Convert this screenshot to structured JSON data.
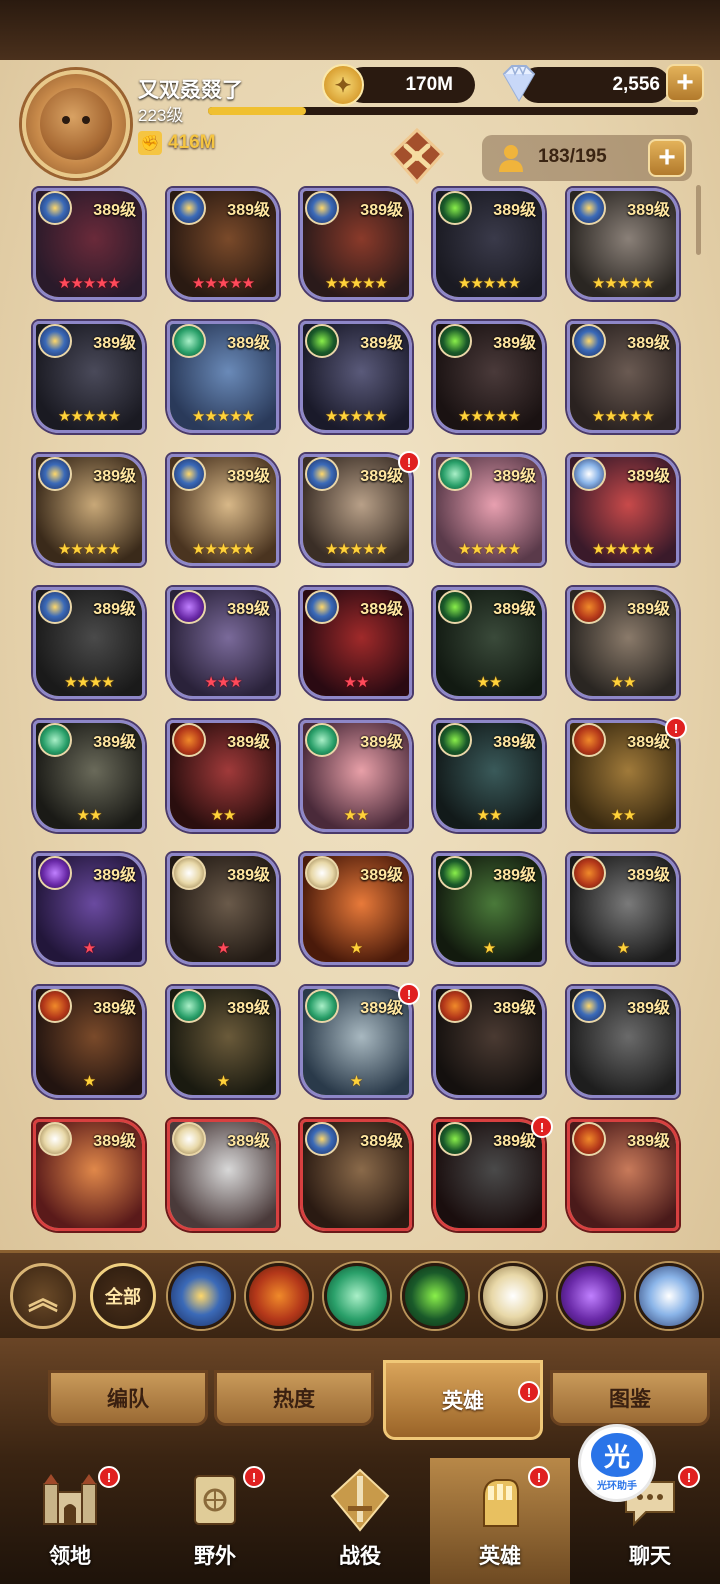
{
  "player": {
    "name": "又双叒叕了",
    "level": "223级",
    "level_progress": 0.2,
    "power": "416M"
  },
  "resources": {
    "gold": "170M",
    "diamonds": "2,556"
  },
  "roster": {
    "count": "183/195"
  },
  "colors": {
    "accent": "#f5c542",
    "alert": "#e02020",
    "card_border": "#8e87c8",
    "card_border_elite": "#d84040"
  },
  "heroes": [
    {
      "level": "389级",
      "stars": 5,
      "star_color": "red",
      "faction": "lightbearer",
      "alert": false,
      "elite": false
    },
    {
      "level": "389级",
      "stars": 5,
      "star_color": "red",
      "faction": "lightbearer",
      "alert": false,
      "elite": false
    },
    {
      "level": "389级",
      "stars": 5,
      "star_color": "gold",
      "faction": "lightbearer",
      "alert": false,
      "elite": false
    },
    {
      "level": "389级",
      "stars": 5,
      "star_color": "gold",
      "faction": "wilder",
      "alert": false,
      "elite": false
    },
    {
      "level": "389级",
      "stars": 5,
      "star_color": "gold",
      "faction": "lightbearer",
      "alert": false,
      "elite": false
    },
    {
      "level": "389级",
      "stars": 5,
      "star_color": "gold",
      "faction": "lightbearer",
      "alert": false,
      "elite": false
    },
    {
      "level": "389级",
      "stars": 5,
      "star_color": "gold",
      "faction": "wilder-green",
      "alert": false,
      "elite": false
    },
    {
      "level": "389级",
      "stars": 5,
      "star_color": "gold",
      "faction": "wilder",
      "alert": false,
      "elite": false
    },
    {
      "level": "389级",
      "stars": 5,
      "star_color": "gold",
      "faction": "wilder",
      "alert": false,
      "elite": false
    },
    {
      "level": "389级",
      "stars": 5,
      "star_color": "gold",
      "faction": "lightbearer",
      "alert": false,
      "elite": false
    },
    {
      "level": "389级",
      "stars": 5,
      "star_color": "gold",
      "faction": "lightbearer",
      "alert": false,
      "elite": false
    },
    {
      "level": "389级",
      "stars": 5,
      "star_color": "gold",
      "faction": "lightbearer",
      "alert": false,
      "elite": false
    },
    {
      "level": "389级",
      "stars": 5,
      "star_color": "gold",
      "faction": "lightbearer",
      "alert": true,
      "elite": false
    },
    {
      "level": "389级",
      "stars": 5,
      "star_color": "gold",
      "faction": "wilder-green",
      "alert": false,
      "elite": false
    },
    {
      "level": "389级",
      "stars": 5,
      "star_color": "gold",
      "faction": "dimensional",
      "alert": false,
      "elite": false
    },
    {
      "level": "389级",
      "stars": 4,
      "star_color": "gold",
      "faction": "lightbearer",
      "alert": false,
      "elite": false
    },
    {
      "level": "389级",
      "stars": 3,
      "star_color": "red",
      "faction": "graveborn",
      "alert": false,
      "elite": false
    },
    {
      "level": "389级",
      "stars": 2,
      "star_color": "red",
      "faction": "lightbearer",
      "alert": false,
      "elite": false
    },
    {
      "level": "389级",
      "stars": 2,
      "star_color": "gold",
      "faction": "wilder",
      "alert": false,
      "elite": false
    },
    {
      "level": "389级",
      "stars": 2,
      "star_color": "gold",
      "faction": "mauler",
      "alert": false,
      "elite": false
    },
    {
      "level": "389级",
      "stars": 2,
      "star_color": "gold",
      "faction": "wilder-green",
      "alert": false,
      "elite": false
    },
    {
      "level": "389级",
      "stars": 2,
      "star_color": "gold",
      "faction": "mauler",
      "alert": false,
      "elite": false
    },
    {
      "level": "389级",
      "stars": 2,
      "star_color": "gold",
      "faction": "wilder-green",
      "alert": false,
      "elite": false
    },
    {
      "level": "389级",
      "stars": 2,
      "star_color": "gold",
      "faction": "wilder",
      "alert": false,
      "elite": false
    },
    {
      "level": "389级",
      "stars": 2,
      "star_color": "gold",
      "faction": "mauler",
      "alert": true,
      "elite": false
    },
    {
      "level": "389级",
      "stars": 1,
      "star_color": "red",
      "faction": "graveborn",
      "alert": false,
      "elite": false
    },
    {
      "level": "389级",
      "stars": 1,
      "star_color": "red",
      "faction": "celestial",
      "alert": false,
      "elite": false
    },
    {
      "level": "389级",
      "stars": 1,
      "star_color": "gold",
      "faction": "celestial",
      "alert": false,
      "elite": false
    },
    {
      "level": "389级",
      "stars": 1,
      "star_color": "gold",
      "faction": "wilder",
      "alert": false,
      "elite": false
    },
    {
      "level": "389级",
      "stars": 1,
      "star_color": "gold",
      "faction": "mauler",
      "alert": false,
      "elite": false
    },
    {
      "level": "389级",
      "stars": 1,
      "star_color": "gold",
      "faction": "mauler",
      "alert": false,
      "elite": false
    },
    {
      "level": "389级",
      "stars": 1,
      "star_color": "gold",
      "faction": "wilder-green",
      "alert": false,
      "elite": false
    },
    {
      "level": "389级",
      "stars": 1,
      "star_color": "gold",
      "faction": "wilder-green",
      "alert": true,
      "elite": false
    },
    {
      "level": "389级",
      "stars": 0,
      "star_color": "gold",
      "faction": "mauler",
      "alert": false,
      "elite": false
    },
    {
      "level": "389级",
      "stars": 0,
      "star_color": "gold",
      "faction": "lightbearer",
      "alert": false,
      "elite": false
    },
    {
      "level": "389级",
      "stars": 0,
      "star_color": "gold",
      "faction": "celestial",
      "alert": false,
      "elite": true
    },
    {
      "level": "389级",
      "stars": 0,
      "star_color": "gold",
      "faction": "celestial",
      "alert": false,
      "elite": true
    },
    {
      "level": "389级",
      "stars": 0,
      "star_color": "gold",
      "faction": "lightbearer",
      "alert": false,
      "elite": true
    },
    {
      "level": "389级",
      "stars": 0,
      "star_color": "gold",
      "faction": "wilder",
      "alert": true,
      "elite": true
    },
    {
      "level": "389级",
      "stars": 0,
      "star_color": "gold",
      "faction": "mauler",
      "alert": false,
      "elite": true
    }
  ],
  "filters": {
    "all_label": "全部",
    "factions": [
      "lightbearer",
      "mauler",
      "wilder-green",
      "wilder",
      "celestial",
      "graveborn",
      "dimensional"
    ]
  },
  "tabs": [
    {
      "label": "编队",
      "active": false,
      "alert": false
    },
    {
      "label": "热度",
      "active": false,
      "alert": false
    },
    {
      "label": "英雄",
      "active": true,
      "alert": true
    },
    {
      "label": "图鉴",
      "active": false,
      "alert": false
    }
  ],
  "nav": [
    {
      "label": "领地",
      "icon": "castle-icon",
      "alert": true,
      "active": false
    },
    {
      "label": "野外",
      "icon": "map-scroll-icon",
      "alert": true,
      "active": false
    },
    {
      "label": "战役",
      "icon": "sword-emblem-icon",
      "alert": false,
      "active": false
    },
    {
      "label": "英雄",
      "icon": "gauntlet-icon",
      "alert": true,
      "active": true
    },
    {
      "label": "聊天",
      "icon": "chat-icon",
      "alert": true,
      "active": false
    }
  ],
  "assistant": {
    "glyph": "光",
    "label": "光环助手"
  }
}
